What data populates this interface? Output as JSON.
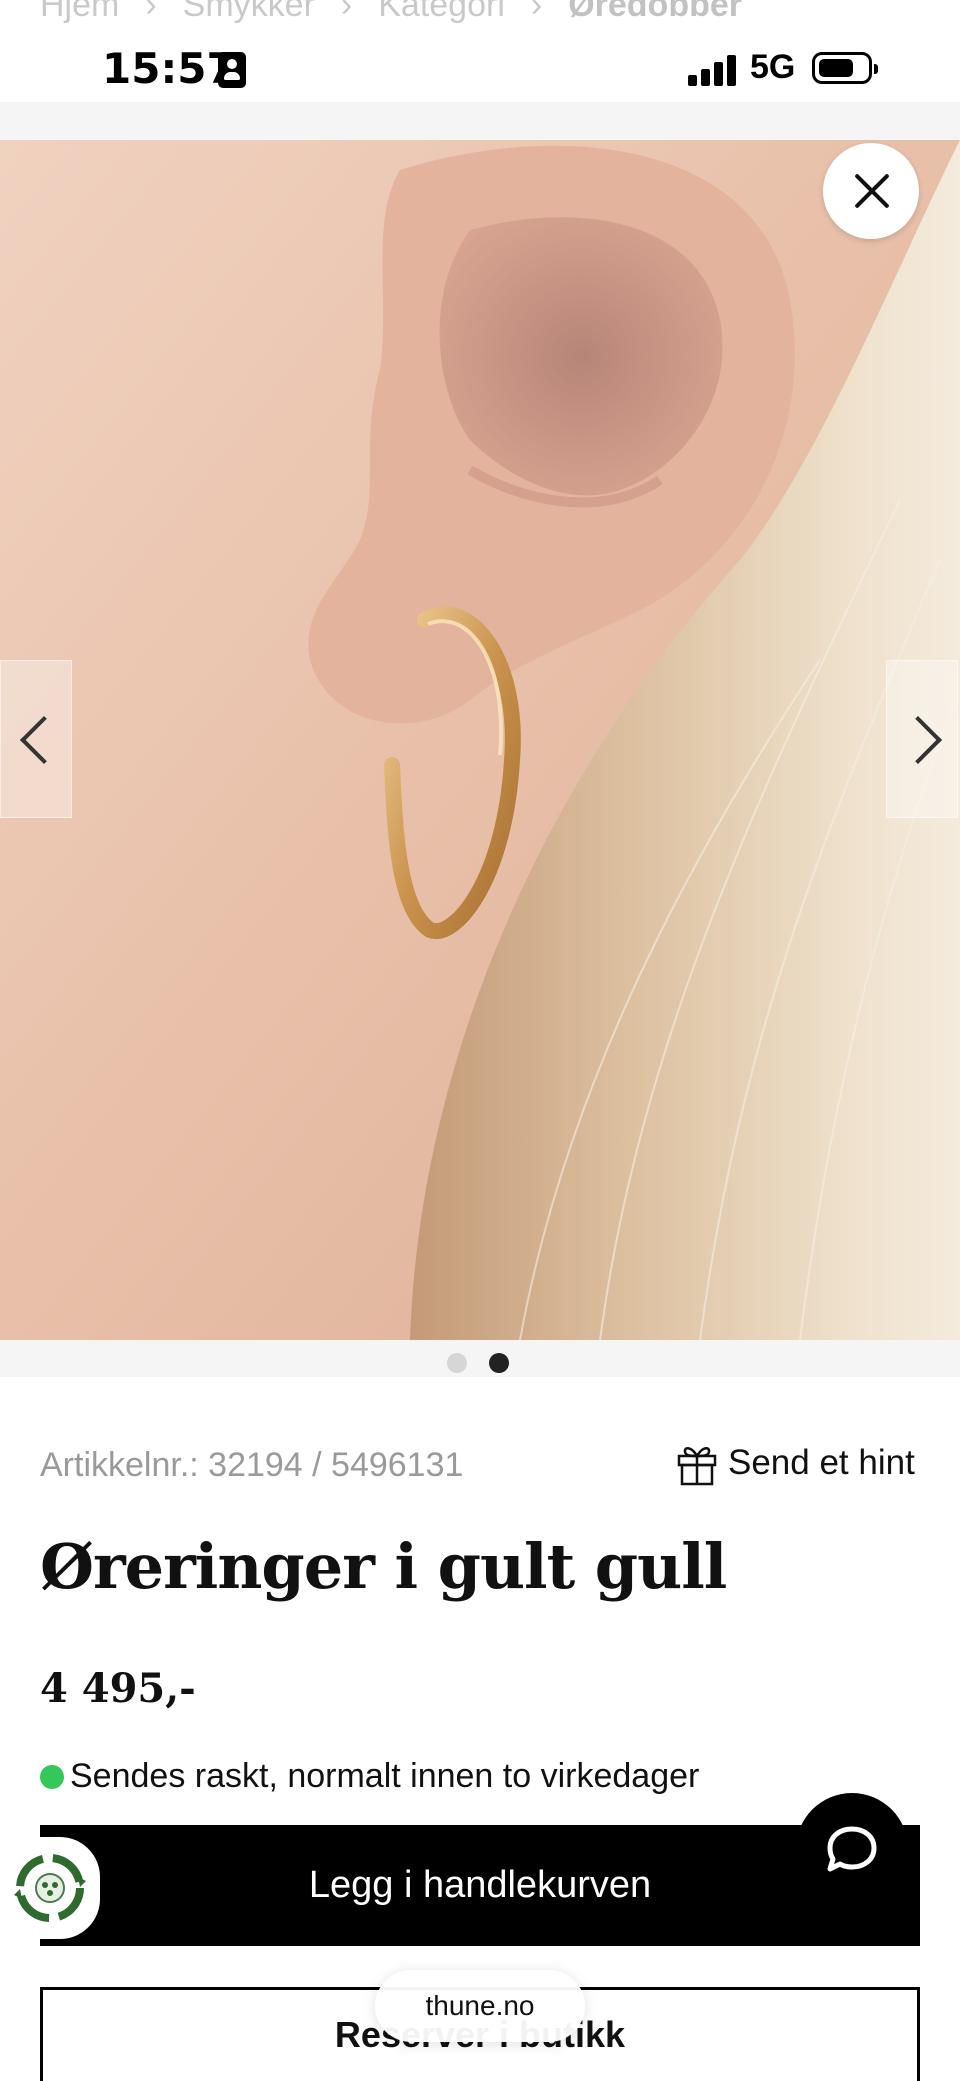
{
  "breadcrumb": [
    "Hjem",
    "Smykker",
    "Kategori",
    "Øredobber"
  ],
  "status_bar": {
    "time": "15:57",
    "network": "5G"
  },
  "gallery": {
    "image_count": 2,
    "active_index": 1
  },
  "product": {
    "sku": "Artikkelnr.: 32194 / 5496131",
    "title": "Øreringer i gult gull",
    "price": "4 495,-",
    "shipping": "Sendes raskt, normalt innen to virkedager",
    "shipping_status_color": "#34c759"
  },
  "actions": {
    "hint_label": "Send et hint",
    "add_to_cart": "Legg i handlekurven",
    "secondary_label": "Reserver i butikk"
  },
  "browser": {
    "url": "thune.no"
  },
  "icons": [
    "close-icon",
    "chevron-left-icon",
    "chevron-right-icon",
    "gift-icon",
    "chat-icon",
    "eco-icon",
    "signal-icon",
    "battery-icon",
    "id-card-icon"
  ]
}
